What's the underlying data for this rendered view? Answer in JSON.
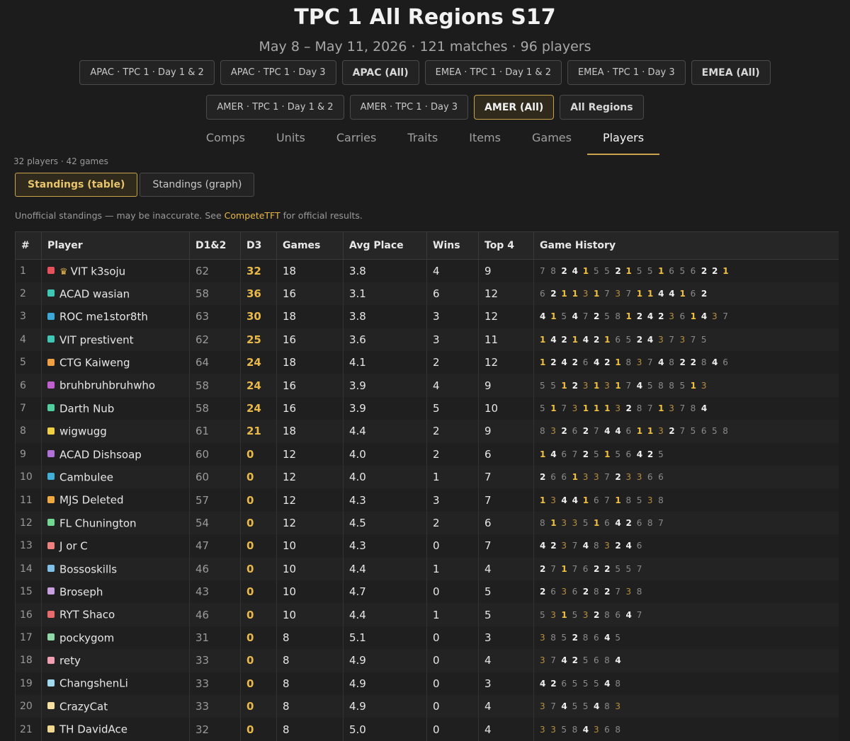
{
  "header": {
    "title": "TPC 1 All Regions S17",
    "subtitle": "May 8 – May 11, 2026 · 121 matches · 96 players"
  },
  "filters": [
    {
      "label": "APAC · TPC 1 · Day 1 & 2",
      "bold": false,
      "active": false
    },
    {
      "label": "APAC · TPC 1 · Day 3",
      "bold": false,
      "active": false
    },
    {
      "label": "APAC (All)",
      "bold": true,
      "active": false
    },
    {
      "label": "EMEA · TPC 1 · Day 1 & 2",
      "bold": false,
      "active": false
    },
    {
      "label": "EMEA · TPC 1 · Day 3",
      "bold": false,
      "active": false
    },
    {
      "label": "EMEA (All)",
      "bold": true,
      "active": false
    },
    {
      "label": "AMER · TPC 1 · Day 1 & 2",
      "bold": false,
      "active": false
    },
    {
      "label": "AMER · TPC 1 · Day 3",
      "bold": false,
      "active": false
    },
    {
      "label": "AMER (All)",
      "bold": true,
      "active": true
    },
    {
      "label": "All Regions",
      "bold": true,
      "active": false
    }
  ],
  "tabs": [
    {
      "label": "Comps",
      "active": false
    },
    {
      "label": "Units",
      "active": false
    },
    {
      "label": "Carries",
      "active": false
    },
    {
      "label": "Traits",
      "active": false
    },
    {
      "label": "Items",
      "active": false
    },
    {
      "label": "Games",
      "active": false
    },
    {
      "label": "Players",
      "active": true
    }
  ],
  "summary": "32 players · 42 games",
  "view_toggle": {
    "table_label": "Standings (table)",
    "graph_label": "Standings (graph)",
    "active": "table"
  },
  "disclaimer": {
    "before": "Unofficial standings — may be inaccurate. See ",
    "link": "CompeteTFT",
    "after": " for official results."
  },
  "table": {
    "headers": {
      "rank": "#",
      "player": "Player",
      "d12": "D1&2",
      "d3": "D3",
      "games": "Games",
      "avg": "Avg Place",
      "wins": "Wins",
      "top4": "Top 4",
      "history": "Game History"
    },
    "rows": [
      {
        "rank": "1",
        "color": "#e8505b",
        "crown": true,
        "name": "VIT k3soju",
        "d12": "62",
        "d3": "32",
        "games": "18",
        "avg": "3.8",
        "wins": "4",
        "top4": "9",
        "history": "782415521551656221"
      },
      {
        "rank": "2",
        "color": "#3cc8b4",
        "crown": false,
        "name": "ACAD wasian",
        "d12": "58",
        "d3": "36",
        "games": "16",
        "avg": "3.1",
        "wins": "6",
        "top4": "12",
        "history": "6211317371144162"
      },
      {
        "rank": "3",
        "color": "#3aa8d8",
        "crown": false,
        "name": "ROC me1stor8th",
        "d12": "63",
        "d3": "30",
        "games": "18",
        "avg": "3.8",
        "wins": "3",
        "top4": "12",
        "history": "415472581242361437"
      },
      {
        "rank": "4",
        "color": "#3cc8b4",
        "crown": false,
        "name": "VIT prestivent",
        "d12": "62",
        "d3": "25",
        "games": "16",
        "avg": "3.6",
        "wins": "3",
        "top4": "11",
        "history": "1421421652437375"
      },
      {
        "rank": "5",
        "color": "#f0a040",
        "crown": false,
        "name": "CTG Kaiweng",
        "d12": "64",
        "d3": "24",
        "games": "18",
        "avg": "4.1",
        "wins": "2",
        "top4": "12",
        "history": "124264218374822846"
      },
      {
        "rank": "6",
        "color": "#c060d0",
        "crown": false,
        "name": "bruhbruhbruhwho",
        "d12": "58",
        "d3": "24",
        "games": "16",
        "avg": "3.9",
        "wins": "4",
        "top4": "9",
        "history": "5512313174588513"
      },
      {
        "rank": "7",
        "color": "#50d0a0",
        "crown": false,
        "name": "Darth Nub",
        "d12": "58",
        "d3": "24",
        "games": "16",
        "avg": "3.9",
        "wins": "5",
        "top4": "10",
        "history": "5173111328713784"
      },
      {
        "rank": "8",
        "color": "#f0d040",
        "crown": false,
        "name": "wigwugg",
        "d12": "61",
        "d3": "21",
        "games": "18",
        "avg": "4.4",
        "wins": "2",
        "top4": "9",
        "history": "832627446113275658"
      },
      {
        "rank": "9",
        "color": "#b070d8",
        "crown": false,
        "name": "ACAD Dishsoap",
        "d12": "60",
        "d3": "0",
        "games": "12",
        "avg": "4.0",
        "wins": "2",
        "top4": "6",
        "history": "146725156425"
      },
      {
        "rank": "10",
        "color": "#40b0d8",
        "crown": false,
        "name": "Cambulee",
        "d12": "60",
        "d3": "0",
        "games": "12",
        "avg": "4.0",
        "wins": "1",
        "top4": "7",
        "history": "266133723366"
      },
      {
        "rank": "11",
        "color": "#f0a840",
        "crown": false,
        "name": "MJS Deleted",
        "d12": "57",
        "d3": "0",
        "games": "12",
        "avg": "4.3",
        "wins": "3",
        "top4": "7",
        "history": "134416718538"
      },
      {
        "rank": "12",
        "color": "#70d890",
        "crown": false,
        "name": "FL Chunington",
        "d12": "54",
        "d3": "0",
        "games": "12",
        "avg": "4.5",
        "wins": "2",
        "top4": "6",
        "history": "813351642687"
      },
      {
        "rank": "13",
        "color": "#f08080",
        "crown": false,
        "name": "J or C",
        "d12": "47",
        "d3": "0",
        "games": "10",
        "avg": "4.3",
        "wins": "0",
        "top4": "7",
        "history": "4237483246"
      },
      {
        "rank": "14",
        "color": "#80c0e8",
        "crown": false,
        "name": "Bossoskills",
        "d12": "46",
        "d3": "0",
        "games": "10",
        "avg": "4.4",
        "wins": "1",
        "top4": "4",
        "history": "2717622557"
      },
      {
        "rank": "15",
        "color": "#c8a0e0",
        "crown": false,
        "name": "Broseph",
        "d12": "43",
        "d3": "0",
        "games": "10",
        "avg": "4.7",
        "wins": "0",
        "top4": "5",
        "history": "2636282738"
      },
      {
        "rank": "16",
        "color": "#e86a6a",
        "crown": false,
        "name": "RYT Shaco",
        "d12": "46",
        "d3": "0",
        "games": "10",
        "avg": "4.4",
        "wins": "1",
        "top4": "5",
        "history": "5315328647"
      },
      {
        "rank": "17",
        "color": "#90d8a8",
        "crown": false,
        "name": "pockygom",
        "d12": "31",
        "d3": "0",
        "games": "8",
        "avg": "5.1",
        "wins": "0",
        "top4": "3",
        "history": "38528645"
      },
      {
        "rank": "18",
        "color": "#f0a0b0",
        "crown": false,
        "name": "rety",
        "d12": "33",
        "d3": "0",
        "games": "8",
        "avg": "4.9",
        "wins": "0",
        "top4": "4",
        "history": "37425684"
      },
      {
        "rank": "19",
        "color": "#a0d8f0",
        "crown": false,
        "name": "ChangshenLi",
        "d12": "33",
        "d3": "0",
        "games": "8",
        "avg": "4.9",
        "wins": "0",
        "top4": "3",
        "history": "42655548"
      },
      {
        "rank": "20",
        "color": "#f8e0a0",
        "crown": false,
        "name": "CrazyCat",
        "d12": "33",
        "d3": "0",
        "games": "8",
        "avg": "4.9",
        "wins": "0",
        "top4": "4",
        "history": "37455483"
      },
      {
        "rank": "21",
        "color": "#f0d890",
        "crown": false,
        "name": "TH DavidAce",
        "d12": "32",
        "d3": "0",
        "games": "8",
        "avg": "5.0",
        "wins": "0",
        "top4": "4",
        "history": "33584368"
      }
    ]
  }
}
